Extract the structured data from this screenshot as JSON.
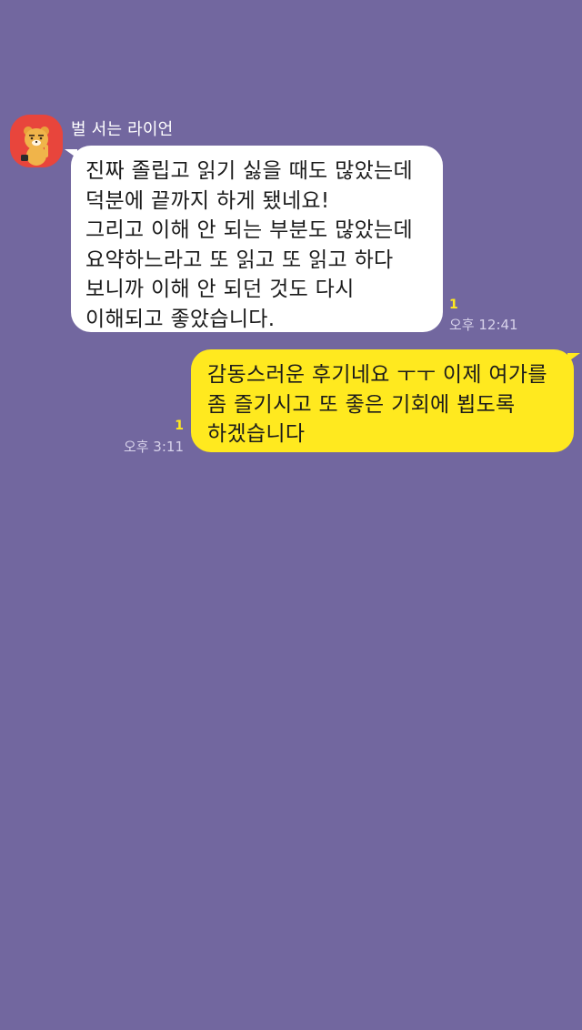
{
  "colors": {
    "background": "#72679f",
    "incoming_bubble": "#ffffff",
    "outgoing_bubble": "#ffe91f",
    "unread_count": "#ffe91f"
  },
  "messages": [
    {
      "direction": "incoming",
      "sender": "벌 서는 라이언",
      "avatar_icon": "ryan-character-icon",
      "text": "진짜 졸립고 읽기 싫을 때도 많았는데\n덕분에 끝까지 하게 됐네요!\n그리고 이해 안 되는 부분도 많았는데\n요약하느라고 또 읽고 또 읽고 하다\n보니까 이해 안 되던 것도 다시\n이해되고 좋았습니다.",
      "unread": "1",
      "time": "오후 12:41"
    },
    {
      "direction": "outgoing",
      "text": "감동스러운 후기네요 ㅜㅜ 이제 여가를\n좀 즐기시고 또 좋은 기회에 뵙도록\n하겠습니다",
      "unread": "1",
      "time": "오후 3:11"
    }
  ]
}
